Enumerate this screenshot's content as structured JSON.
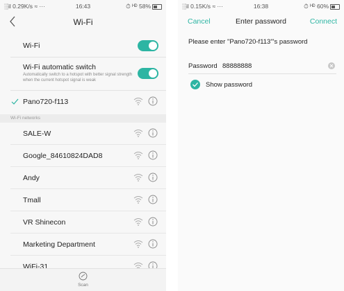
{
  "left": {
    "status": {
      "left": "░il 0.29K/s ≈ ···",
      "time": "16:43",
      "right": "⏱ ᴴᴰ 58%",
      "battery_level": 0.58
    },
    "header": {
      "title": "Wi-Fi"
    },
    "wifi_toggle": {
      "label": "Wi-Fi",
      "on": true
    },
    "auto_switch": {
      "label": "Wi-Fi automatic switch",
      "description": "Automatically switch to a hotspot with better signal strength when the current hotspot signal is weak",
      "on": true
    },
    "connected": {
      "name": "Pano720-f113"
    },
    "section_title": "Wi-Fi networks",
    "networks": [
      {
        "name": "SALE-W"
      },
      {
        "name": "Google_84610824DAD8"
      },
      {
        "name": "Andy"
      },
      {
        "name": "Tmall"
      },
      {
        "name": "VR Shinecon"
      },
      {
        "name": "Marketing Department"
      },
      {
        "name": "WiFi-31"
      }
    ],
    "bottom": {
      "scan_label": "Scan"
    },
    "colors": {
      "accent": "#2db5a3"
    },
    "icons": {
      "wifi": "wifi-signal-icon",
      "info": "info-icon",
      "scan": "scan-icon",
      "check": "check-icon",
      "back": "back-chevron-icon"
    }
  },
  "right": {
    "status": {
      "left": "░il 0.15K/s ≈ ···",
      "time": "16:38",
      "right": "⏱ ᴴᴰ 60%",
      "battery_level": 0.6
    },
    "header": {
      "cancel": "Cancel",
      "title": "Enter password",
      "connect": "Connect"
    },
    "prompt": "Please enter \"Pano720-f113\"'s password",
    "password": {
      "label": "Password",
      "value": "88888888"
    },
    "show_password": {
      "label": "Show password",
      "checked": true
    }
  }
}
